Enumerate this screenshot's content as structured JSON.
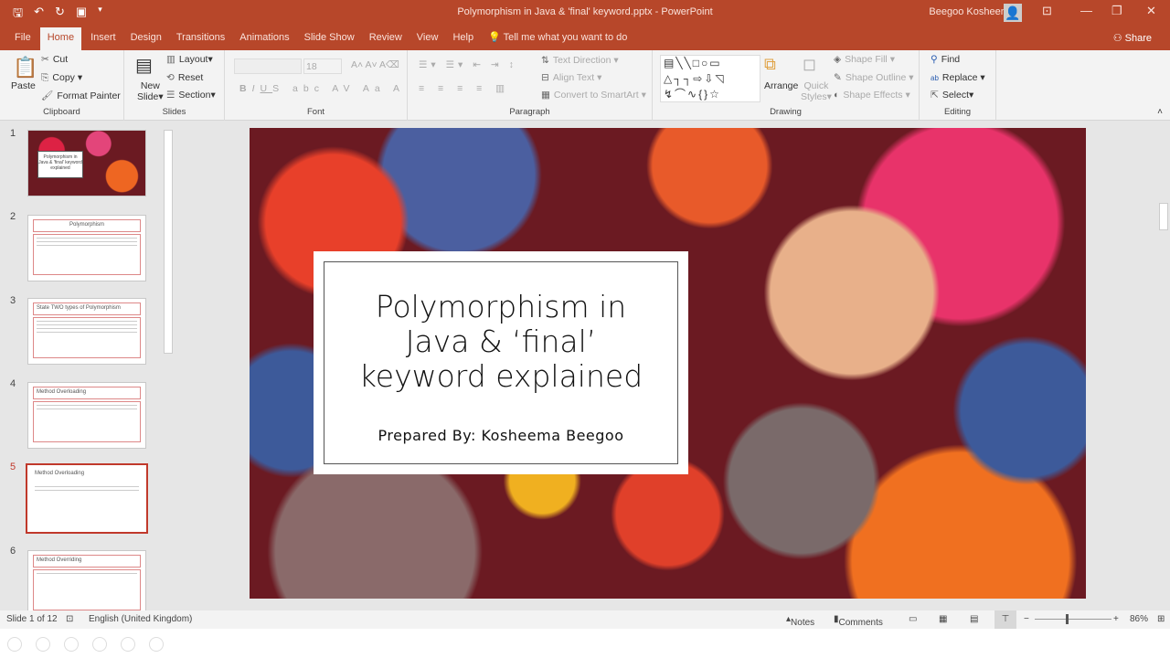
{
  "window": {
    "title": "Polymorphism in Java & 'final' keyword.pptx  -  PowerPoint",
    "user": "Beegoo Kosheema",
    "share": "Share"
  },
  "tabs": [
    "File",
    "Home",
    "Insert",
    "Design",
    "Transitions",
    "Animations",
    "Slide Show",
    "Review",
    "View",
    "Help"
  ],
  "tell_me": "Tell me what you want to do",
  "ribbon": {
    "clipboard": {
      "label": "Clipboard",
      "paste": "Paste",
      "cut": "Cut",
      "copy": "Copy",
      "format_painter": "Format Painter"
    },
    "slides": {
      "label": "Slides",
      "new_slide_1": "New",
      "new_slide_2": "Slide",
      "layout": "Layout",
      "reset": "Reset",
      "section": "Section"
    },
    "font": {
      "label": "Font",
      "size": "18"
    },
    "paragraph": {
      "label": "Paragraph",
      "text_direction": "Text Direction",
      "align_text": "Align Text",
      "smartart": "Convert to SmartArt"
    },
    "drawing": {
      "label": "Drawing",
      "arrange": "Arrange",
      "quick_styles_1": "Quick",
      "quick_styles_2": "Styles",
      "shape_fill": "Shape Fill",
      "shape_outline": "Shape Outline",
      "shape_effects": "Shape Effects"
    },
    "editing": {
      "label": "Editing",
      "find": "Find",
      "replace": "Replace",
      "select": "Select"
    }
  },
  "thumbnails": [
    {
      "num": "1",
      "title": "Polymorphism in Java & 'final' keyword explained"
    },
    {
      "num": "2",
      "title": "Polymorphism"
    },
    {
      "num": "3",
      "title": "State TWO types of Polymorphism"
    },
    {
      "num": "4",
      "title": "Method Overloading"
    },
    {
      "num": "5",
      "title": "Method Overloading"
    },
    {
      "num": "6",
      "title": "Method Overriding"
    }
  ],
  "slide": {
    "title": "Polymorphism in Java & ‘final’ keyword explained",
    "subtitle": "Prepared By: Kosheema Beegoo"
  },
  "status": {
    "slide": "Slide 1 of 12",
    "language": "English (United Kingdom)",
    "notes": "Notes",
    "comments": "Comments",
    "zoom": "86%",
    "zoom_level": 0.86
  }
}
